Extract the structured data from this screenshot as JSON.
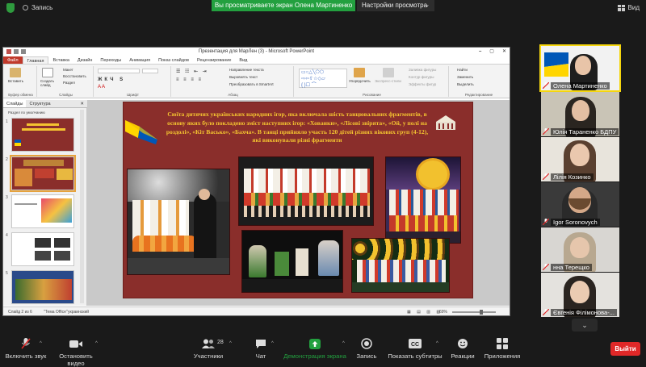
{
  "zoom": {
    "recording_label": "Запись",
    "share_banner": "Вы просматриваете экран Олена Мартиненко",
    "view_settings_label": "Настройки просмотра",
    "view_mode_label": "Вид",
    "leave_button": "Выйти",
    "toolbar": {
      "unmute": "Включить звук",
      "start_video": "Остановить видео",
      "participants": "Участники",
      "participants_count": "28",
      "chat": "Чат",
      "share_screen": "Демонстрация экрана",
      "record": "Запись",
      "captions": "Показать субтитры",
      "reactions": "Реакции",
      "apps": "Приложения"
    },
    "participants": [
      {
        "name": "Олена Мартиненко",
        "active": true
      },
      {
        "name": "Юлія Тараненко БДПУ",
        "active": false
      },
      {
        "name": "Лілія Козинко",
        "active": false
      },
      {
        "name": "Igor Soronovych",
        "active": false
      },
      {
        "name": "нна Терещко",
        "active": false
      },
      {
        "name": "Євгенія Філімонова-...",
        "active": false
      }
    ],
    "colors": {
      "share_green": "#23a03f",
      "leave_red": "#e02828",
      "active_speaker": "#f5d60e"
    }
  },
  "powerpoint": {
    "window_title": "Презентация для МарЛен (3)  -  Microsoft PowerPoint",
    "tabs": [
      "Файл",
      "Главная",
      "Вставка",
      "Дизайн",
      "Переходы",
      "Анимация",
      "Показ слайдов",
      "Рецензирование",
      "Вид"
    ],
    "ribbon": {
      "paste": "Вставить",
      "clipboard": "Буфер обмена",
      "create_slide": "Создать слайд",
      "layout": "Макет",
      "restore": "Восстановить",
      "section": "Раздел",
      "slides_group": "Слайды",
      "font_group": "Шрифт",
      "paragraph_group": "Абзац",
      "text_direction": "Направление текста",
      "align_text": "Выровнять текст",
      "convert_smartart": "Преобразовать в SmartArt",
      "drawing_group": "Рисование",
      "arrange": "Упорядочить",
      "quick_styles": "Экспресс-стили",
      "shape_fill": "Заливка фигуры",
      "shape_outline": "Контур фигуры",
      "shape_effects": "Эффекты фигур",
      "find": "Найти",
      "replace": "Заменить",
      "select": "Выделить",
      "editing_group": "Редактирование"
    },
    "panel_tabs": {
      "slides": "Слайды",
      "outline": "Структура"
    },
    "section_label": "Раздел по умолчанию",
    "status": {
      "slide": "Слайд 2 из 6",
      "theme": "\"Тема Office\"",
      "language": "украинский",
      "zoom": "69%"
    },
    "slide": {
      "text": "Сюїта дитячих українських народних ігор, яка включала шість танцювальних фрагментів, в основу яких було покладено зміст наступних ігор: «Хованки», «Лісові звірята», «Ой, у полі на роздолі», «Кіт Васько», «Бахча». В танці прийняло участь 120 дітей різних вікових груп (4-12), які виконували різні фрагменти",
      "background": "#8a2e2b",
      "text_color": "#f4c430"
    }
  }
}
